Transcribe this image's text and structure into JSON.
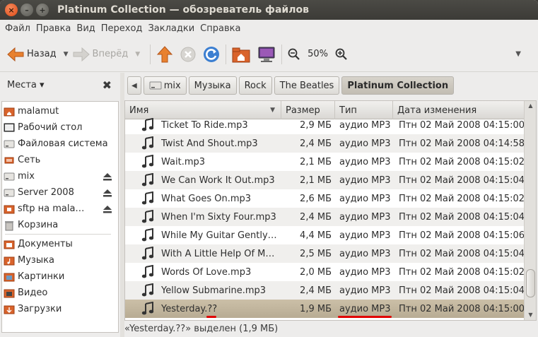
{
  "window": {
    "title": "Platinum Collection — обозреватель файлов"
  },
  "menu": [
    "Файл",
    "Правка",
    "Вид",
    "Переход",
    "Закладки",
    "Справка"
  ],
  "toolbar": {
    "back_label": "Назад",
    "forward_label": "Вперёд",
    "zoom_level": "50%"
  },
  "sidebar": {
    "header": "Места",
    "items": [
      {
        "label": "malamut",
        "icon": "home-folder-icon"
      },
      {
        "label": "Рабочий стол",
        "icon": "desktop-icon"
      },
      {
        "label": "Файловая система",
        "icon": "drive-icon"
      },
      {
        "label": "Сеть",
        "icon": "network-icon"
      },
      {
        "label": "mix",
        "icon": "drive-icon",
        "eject": true
      },
      {
        "label": "Server 2008",
        "icon": "drive-icon",
        "eject": true
      },
      {
        "label": "sftp на mala…",
        "icon": "remote-folder-icon",
        "eject": true
      },
      {
        "label": "Корзина",
        "icon": "trash-icon"
      },
      {
        "label": "Документы",
        "icon": "folder-icon"
      },
      {
        "label": "Музыка",
        "icon": "music-folder-icon"
      },
      {
        "label": "Картинки",
        "icon": "pictures-folder-icon"
      },
      {
        "label": "Видео",
        "icon": "video-folder-icon"
      },
      {
        "label": "Загрузки",
        "icon": "downloads-folder-icon"
      }
    ]
  },
  "pathbar": {
    "crumbs": [
      "mix",
      "Музыка",
      "Rock",
      "The Beatles",
      "Platinum Collection"
    ]
  },
  "columns": {
    "name": "Имя",
    "size": "Размер",
    "type": "Тип",
    "date": "Дата изменения"
  },
  "files": [
    {
      "name": "Ticket To Ride.mp3",
      "size": "2,9 МБ",
      "type": "аудио MP3",
      "date": "Птн 02 Май 2008 04:15:00"
    },
    {
      "name": "Twist And Shout.mp3",
      "size": "2,4 МБ",
      "type": "аудио MP3",
      "date": "Птн 02 Май 2008 04:14:58"
    },
    {
      "name": "Wait.mp3",
      "size": "2,1 МБ",
      "type": "аудио MP3",
      "date": "Птн 02 Май 2008 04:15:02"
    },
    {
      "name": "We Can Work It Out.mp3",
      "size": "2,1 МБ",
      "type": "аудио MP3",
      "date": "Птн 02 Май 2008 04:15:04"
    },
    {
      "name": "What Goes On.mp3",
      "size": "2,6 МБ",
      "type": "аудио MP3",
      "date": "Птн 02 Май 2008 04:15:02"
    },
    {
      "name": "When I'm Sixty Four.mp3",
      "size": "2,4 МБ",
      "type": "аудио MP3",
      "date": "Птн 02 Май 2008 04:15:04"
    },
    {
      "name": "While My Guitar Gently…",
      "size": "4,4 МБ",
      "type": "аудио MP3",
      "date": "Птн 02 Май 2008 04:15:06"
    },
    {
      "name": "With A Little Help Of M…",
      "size": "2,5 МБ",
      "type": "аудио MP3",
      "date": "Птн 02 Май 2008 04:15:04"
    },
    {
      "name": "Words Of Love.mp3",
      "size": "2,0 МБ",
      "type": "аудио MP3",
      "date": "Птн 02 Май 2008 04:15:02"
    },
    {
      "name": "Yellow Submarine.mp3",
      "size": "2,4 МБ",
      "type": "аудио MP3",
      "date": "Птн 02 Май 2008 04:15:04"
    },
    {
      "name": "Yesterday.??",
      "size": "1,9 МБ",
      "type": "аудио MP3",
      "date": "Птн 02 Май 2008 04:15:00",
      "selected": true
    }
  ],
  "status": "«Yesterday.??» выделен (1,9 МБ)",
  "colors": {
    "titlebar": "#3c3b37",
    "selection": "#c2b69e",
    "close_button": "#df4a16",
    "annotation": "#e00000"
  }
}
